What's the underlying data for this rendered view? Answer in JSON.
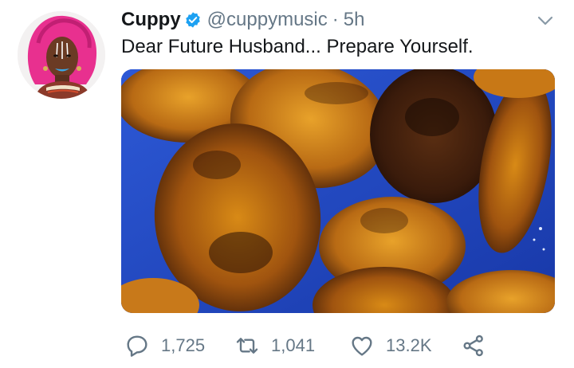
{
  "tweet": {
    "author_name": "Cuppy",
    "handle": "@cuppymusic",
    "separator": "·",
    "timestamp": "5h",
    "text": "Dear Future Husband... Prepare Yourself.",
    "verified": true
  },
  "actions": {
    "replies": "1,725",
    "retweets": "1,041",
    "likes": "13.2K"
  },
  "icons": {
    "verified": "verified-badge-icon",
    "more": "chevron-down-icon",
    "reply": "reply-icon",
    "retweet": "retweet-icon",
    "like": "heart-icon",
    "share": "share-icon"
  },
  "colors": {
    "verified": "#1da1f2",
    "secondary_text": "#657786",
    "primary_text": "#14171a"
  }
}
